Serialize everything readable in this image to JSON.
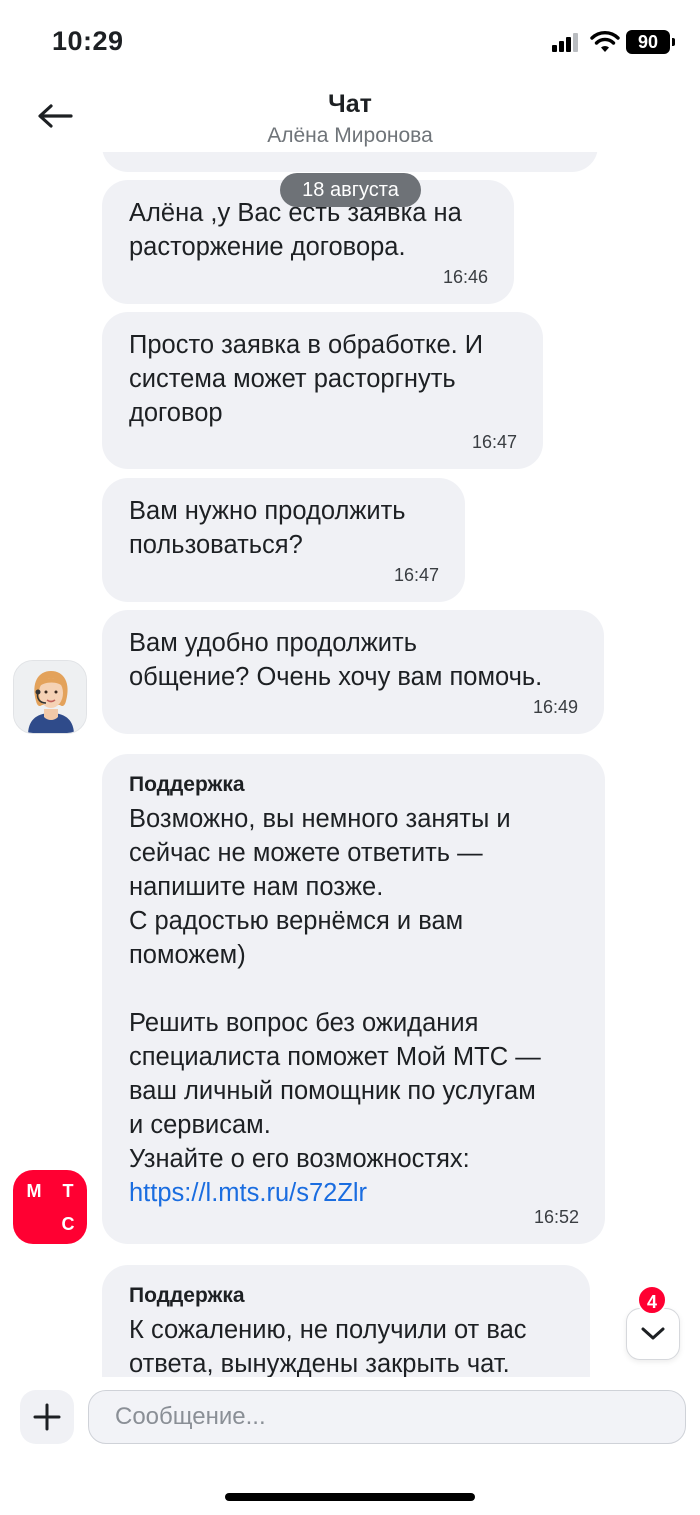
{
  "status_bar": {
    "time": "10:29",
    "battery": "90"
  },
  "header": {
    "title": "Чат",
    "subtitle": "Алёна Миронова"
  },
  "date_separator": "18 августа",
  "messages": [
    {
      "text": "Алёна ,у Вас есть заявка на\nрасторжение договора.",
      "time": "16:46"
    },
    {
      "text": "Просто заявка в обработке. И\nсистема может расторгнуть\nдоговор",
      "time": "16:47"
    },
    {
      "text": "Вам нужно продолжить\nпользоваться?",
      "time": "16:47"
    },
    {
      "text": "Вам удобно продолжить\nобщение? Очень хочу вам помочь.",
      "time": "16:49"
    },
    {
      "sender": "Поддержка",
      "text": "Возможно, вы немного заняты и\nсейчас не можете ответить —\nнапишите нам позже.\nС радостью вернёмся и вам\nпоможем)\n\nРешить вопрос без ожидания\nспециалиста поможет Мой МТС —\nваш личный помощник по услугам\nи сервисам.\nУзнайте о его возможностях:",
      "link": "https://l.mts.ru/s72Zlr",
      "time": "16:52"
    },
    {
      "sender": "Поддержка",
      "text": "К сожалению, не получили от вас\nответа, вынуждены закрыть чат."
    }
  ],
  "mts_logo": {
    "letters": [
      "М",
      "Т",
      "С"
    ]
  },
  "scroll_button": {
    "unread_count": "4"
  },
  "composer": {
    "placeholder": "Сообщение..."
  },
  "colors": {
    "bubble": "#f0f1f5",
    "accent": "#ff0032",
    "link": "#1a6de0",
    "date_pill": "#6e7277"
  }
}
